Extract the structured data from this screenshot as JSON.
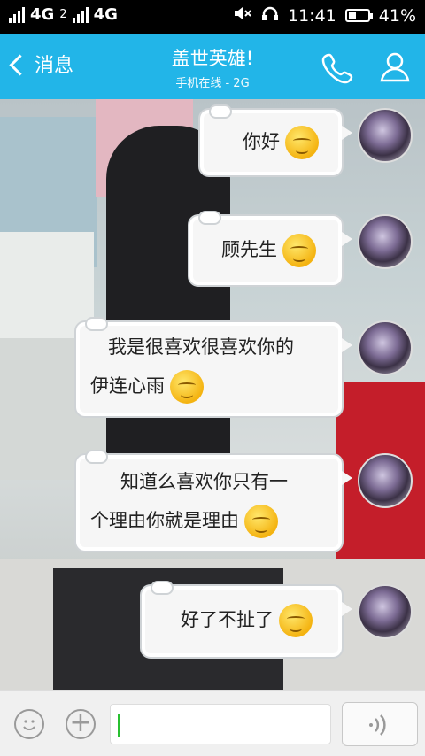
{
  "status_bar": {
    "network_1": "4G",
    "network_2": "4G",
    "sim_2": "2",
    "time": "11:41",
    "battery": "41%",
    "battery_level": 0.41
  },
  "header": {
    "back_label": "消息",
    "contact_name": "盖世英雄!",
    "contact_status": "手机在线 - 2G",
    "phone_icon": "phone-icon",
    "profile_icon": "person-icon"
  },
  "messages": [
    {
      "text": "你好",
      "emoji": true
    },
    {
      "text": "顾先生",
      "emoji": true
    },
    {
      "text_lines": [
        "我是很喜欢很喜欢你的",
        "伊连心雨"
      ],
      "emoji": true
    },
    {
      "text_lines": [
        "知道么喜欢你只有一",
        "个理由你就是理由"
      ],
      "emoji": true
    },
    {
      "text": "好了不扯了",
      "emoji": true
    }
  ],
  "input_bar": {
    "emoji_icon": "smiley-icon",
    "plus_icon": "plus-icon",
    "text_value": "",
    "voice_icon": "voice-icon"
  },
  "colors": {
    "header": "#22b5e8",
    "bubble": "#f6f6f6",
    "cursor": "#28c030"
  }
}
